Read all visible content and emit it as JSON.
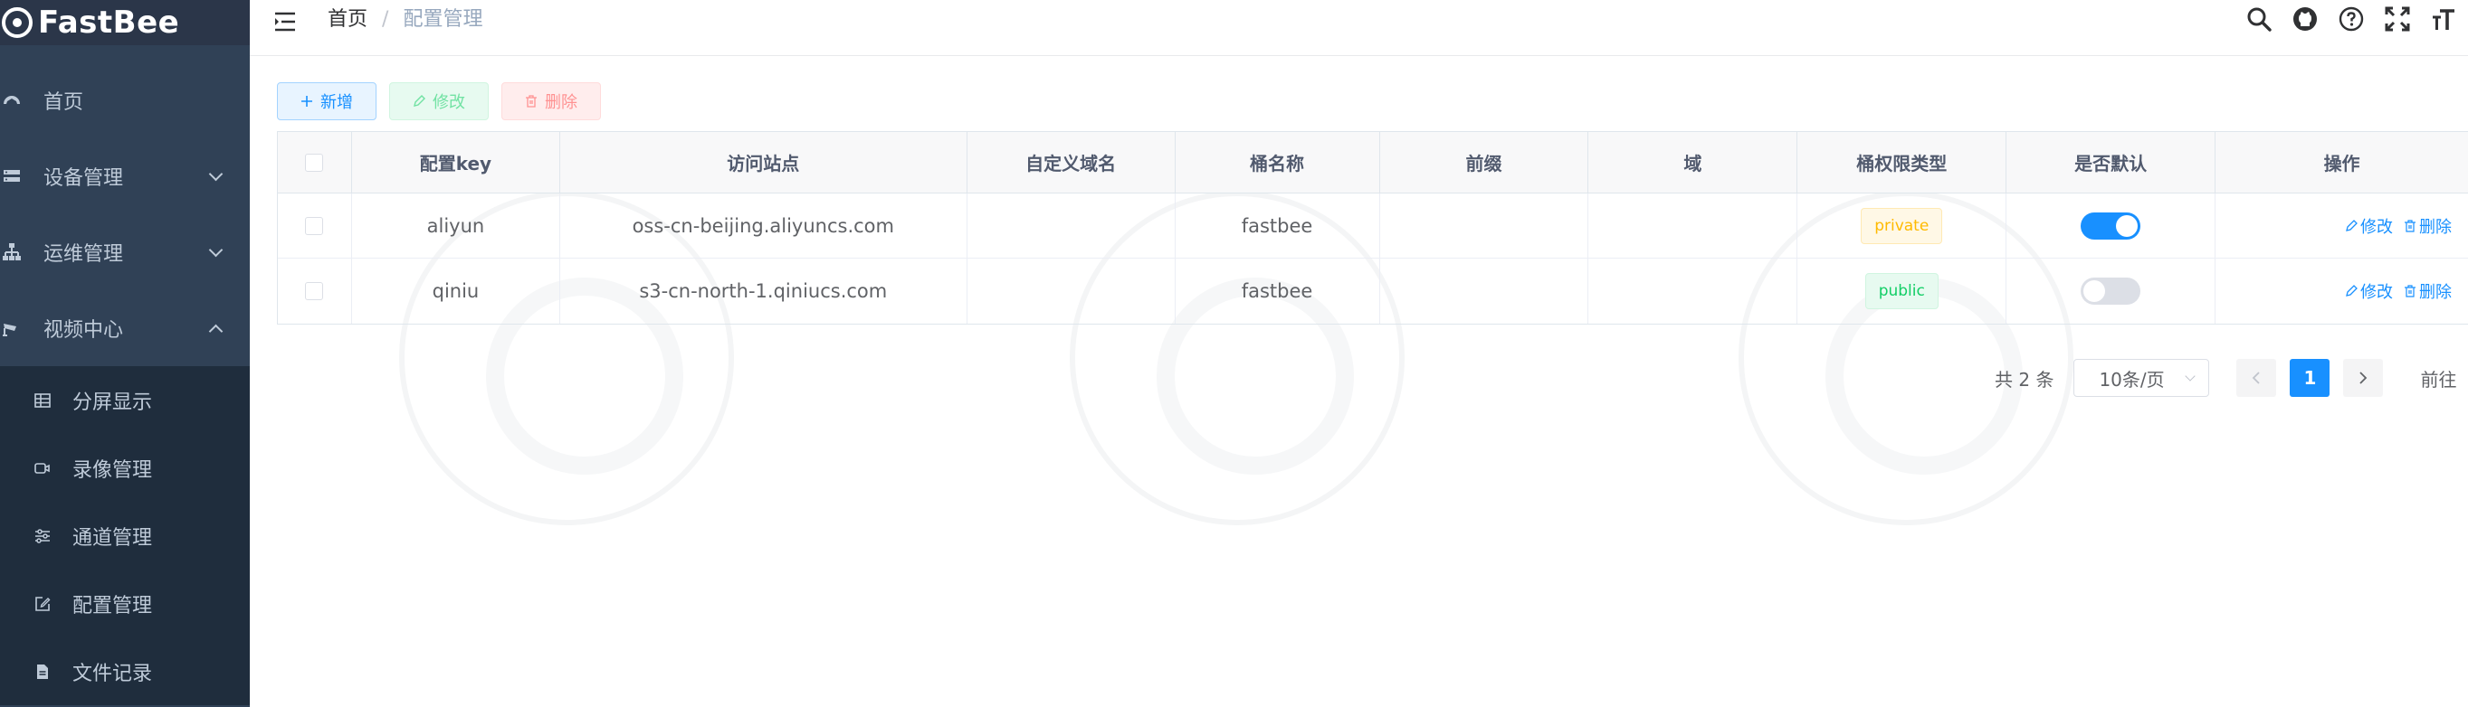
{
  "app": {
    "name": "FastBee"
  },
  "sidebar": {
    "items": [
      {
        "label": "首页",
        "icon": "dashboard-icon"
      },
      {
        "label": "设备管理",
        "icon": "device-icon",
        "expanded": false
      },
      {
        "label": "运维管理",
        "icon": "tree-icon",
        "expanded": false
      },
      {
        "label": "视频中心",
        "icon": "camera-icon",
        "expanded": true
      }
    ],
    "subitems": [
      {
        "label": "分屏显示",
        "icon": "split-screen-icon"
      },
      {
        "label": "录像管理",
        "icon": "video-icon"
      },
      {
        "label": "通道管理",
        "icon": "sliders-icon"
      },
      {
        "label": "配置管理",
        "icon": "edit-icon"
      },
      {
        "label": "文件记录",
        "icon": "file-icon"
      }
    ]
  },
  "breadcrumb": {
    "home": "首页",
    "separator": "/",
    "current": "配置管理"
  },
  "toolbar": {
    "add": "新增",
    "edit": "修改",
    "delete": "删除"
  },
  "table": {
    "columns": [
      "配置key",
      "访问站点",
      "自定义域名",
      "桶名称",
      "前缀",
      "域",
      "桶权限类型",
      "是否默认",
      "操作"
    ],
    "rows": [
      {
        "key": "aliyun",
        "endpoint": "oss-cn-beijing.aliyuncs.com",
        "domain": "",
        "bucket": "fastbee",
        "prefix": "",
        "region": "",
        "access": "private",
        "access_status": "warning",
        "is_default": true
      },
      {
        "key": "qiniu",
        "endpoint": "s3-cn-north-1.qiniucs.com",
        "domain": "",
        "bucket": "fastbee",
        "prefix": "",
        "region": "",
        "access": "public",
        "access_status": "success",
        "is_default": false
      }
    ],
    "ops": {
      "edit": "修改",
      "delete": "删除"
    }
  },
  "pagination": {
    "total": "共 2 条",
    "page_size": "10条/页",
    "current_page": "1",
    "goto": "前往"
  },
  "colors": {
    "sidebar": "#304156",
    "sidebar_sub": "#1f2d3d",
    "primary": "#1890ff",
    "success": "#13ce66",
    "warning": "#ffba00",
    "danger": "#ff4949"
  }
}
